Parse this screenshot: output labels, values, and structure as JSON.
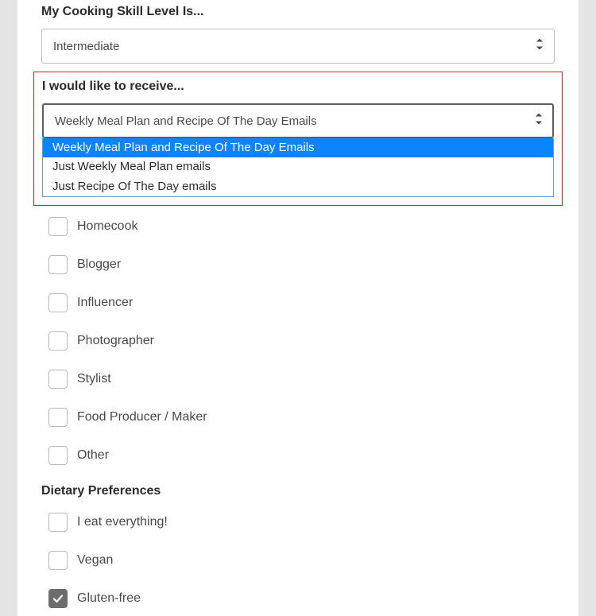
{
  "skill": {
    "label": "My Cooking Skill Level Is...",
    "value": "Intermediate"
  },
  "receive": {
    "label": "I would like to receive...",
    "value": "Weekly Meal Plan and Recipe Of The Day Emails",
    "options": [
      "Weekly Meal Plan and Recipe Of The Day Emails",
      "Just Weekly Meal Plan emails",
      "Just Recipe Of The Day emails"
    ]
  },
  "roles": {
    "items": [
      {
        "label": "Homecook",
        "checked": false
      },
      {
        "label": "Blogger",
        "checked": false
      },
      {
        "label": "Influencer",
        "checked": false
      },
      {
        "label": "Photographer",
        "checked": false
      },
      {
        "label": "Stylist",
        "checked": false
      },
      {
        "label": "Food Producer / Maker",
        "checked": false
      },
      {
        "label": "Other",
        "checked": false
      }
    ]
  },
  "dietary": {
    "heading": "Dietary Preferences",
    "items": [
      {
        "label": "I eat everything!",
        "checked": false
      },
      {
        "label": "Vegan",
        "checked": false
      },
      {
        "label": "Gluten-free",
        "checked": true
      }
    ]
  }
}
